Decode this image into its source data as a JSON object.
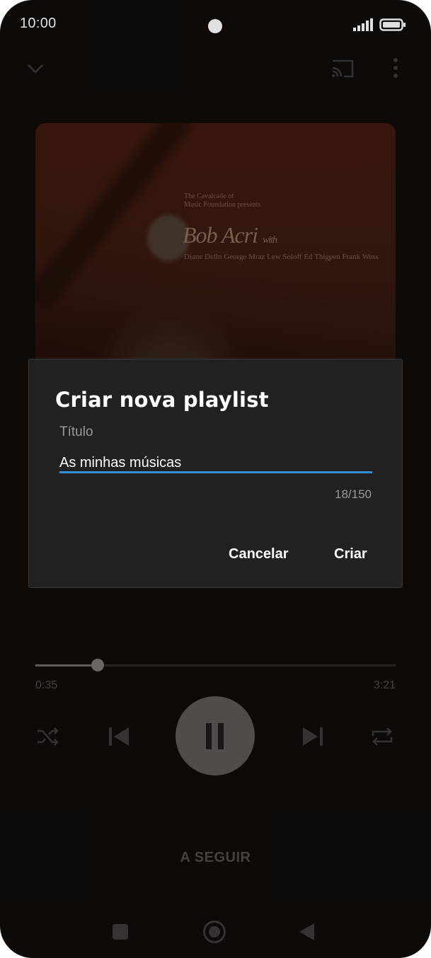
{
  "status_bar": {
    "time": "10:00"
  },
  "album_art": {
    "small_text": "The Cavalcade of\nMusic Foundation presents",
    "big_text": "Bob Acri",
    "big_suffix": "with",
    "names": "Diane Delin George Mraz Lew Soloff Ed Thigpen Frank Wess"
  },
  "dialog": {
    "title": "Criar nova playlist",
    "field_label": "Título",
    "field_value": "As minhas músicas",
    "counter": "18/150",
    "cancel_label": "Cancelar",
    "create_label": "Criar",
    "accent_color": "#2f8fd8"
  },
  "player": {
    "current_time": "0:35",
    "total_time": "3:21",
    "progress_fraction": 0.174,
    "up_next_label": "A SEGUIR"
  },
  "icons": {
    "collapse": "chevron-down-icon",
    "cast": "cast-icon",
    "more": "more-vert-icon",
    "shuffle": "shuffle-icon",
    "previous": "skip-previous-icon",
    "play_pause": "pause-icon",
    "next": "skip-next-icon",
    "repeat": "repeat-icon"
  }
}
